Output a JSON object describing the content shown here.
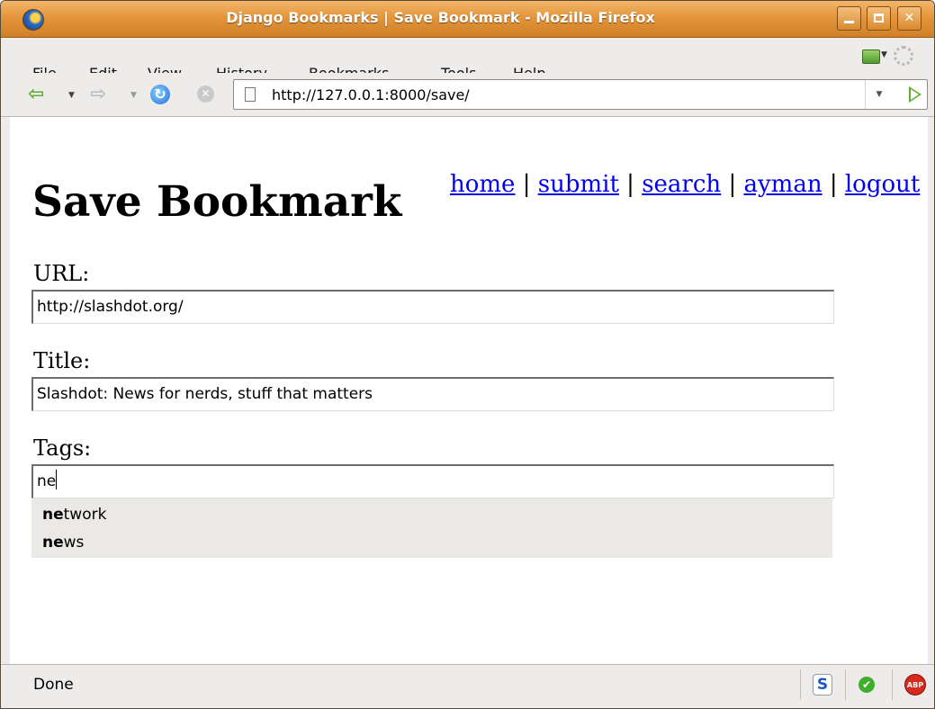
{
  "window": {
    "title": "Django Bookmarks | Save Bookmark - Mozilla Firefox"
  },
  "menubar": {
    "items": [
      {
        "prefix": "",
        "mnemonic": "F",
        "rest": "ile"
      },
      {
        "prefix": "",
        "mnemonic": "E",
        "rest": "dit"
      },
      {
        "prefix": "",
        "mnemonic": "V",
        "rest": "iew"
      },
      {
        "prefix": "Hi",
        "mnemonic": "s",
        "rest": "tory"
      },
      {
        "prefix": "",
        "mnemonic": "B",
        "rest": "ookmarks"
      },
      {
        "prefix": "",
        "mnemonic": "T",
        "rest": "ools"
      },
      {
        "prefix": "",
        "mnemonic": "H",
        "rest": "elp"
      }
    ]
  },
  "navbar": {
    "url": "http://127.0.0.1:8000/save/",
    "icons": [
      "back-icon",
      "forward-icon",
      "reload-icon",
      "stop-icon",
      "page-icon",
      "go-icon"
    ]
  },
  "page": {
    "title": "Save Bookmark",
    "links": [
      "home",
      "submit",
      "search",
      "ayman",
      "logout"
    ],
    "separator": "|",
    "fields": {
      "url": {
        "label": "URL:",
        "value": "http://slashdot.org/"
      },
      "title": {
        "label": "Title:",
        "value": "Slashdot: News for nerds, stuff that matters"
      },
      "tags": {
        "label": "Tags:",
        "value": "ne"
      }
    },
    "autocomplete": [
      {
        "match": "ne",
        "rest": "twork"
      },
      {
        "match": "ne",
        "rest": "ws"
      }
    ]
  },
  "statusbar": {
    "text": "Done",
    "icons": [
      "s-icon",
      "check-icon",
      "adblock-icon"
    ],
    "abp_label": "ABP"
  },
  "colors": {
    "titlebar": "#e4963c",
    "link": "#0000ee",
    "autocomplete_bg": "#ebe9e6"
  }
}
